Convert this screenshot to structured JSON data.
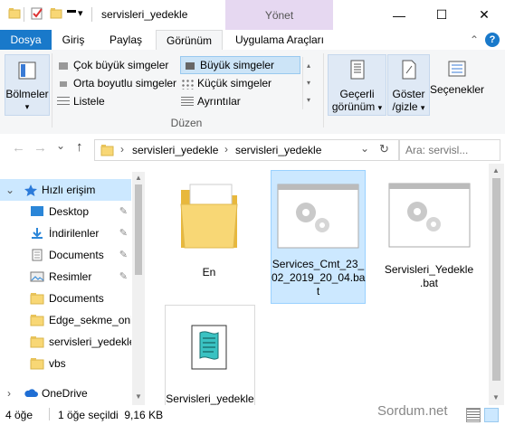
{
  "window": {
    "title": "servisleri_yedekle",
    "manage_label": "Yönet",
    "minimize": "—",
    "maximize": "☐",
    "close": "✕",
    "qa_dropdown": "▾"
  },
  "tabs": {
    "file": "Dosya",
    "home": "Giriş",
    "share": "Paylaş",
    "view": "Görünüm",
    "app_tools": "Uygulama Araçları",
    "collapse": "⌃",
    "help": "?"
  },
  "ribbon": {
    "panes": "Bölmeler",
    "panes_arrow": "▾",
    "layout_options": [
      "Çok büyük simgeler",
      "Büyük simgeler",
      "Orta boyutlu simgeler",
      "Küçük simgeler",
      "Listele",
      "Ayrıntılar"
    ],
    "layout_group": "Düzen",
    "current_view_line1": "Geçerli",
    "current_view_line2": "görünüm",
    "show_hide_line1": "Göster",
    "show_hide_line2": "/gizle",
    "options": "Seçenekler",
    "dropdown_arrow": "▾"
  },
  "nav": {
    "back": "←",
    "forward": "→",
    "recent": "⌄",
    "up": "↑",
    "breadcrumb_sep": "›",
    "breadcrumb": [
      "servisleri_yedekle",
      "servisleri_yedekle"
    ],
    "address_dropdown": "⌄",
    "refresh": "↻",
    "search_placeholder": "Ara: servisl..."
  },
  "sidebar": {
    "quick_access": "Hızlı erişim",
    "items": [
      {
        "label": "Desktop",
        "pinned": true
      },
      {
        "label": "İndirilenler",
        "pinned": true
      },
      {
        "label": "Documents",
        "pinned": true
      },
      {
        "label": "Resimler",
        "pinned": true
      },
      {
        "label": "Documents",
        "pinned": false
      },
      {
        "label": "Edge_sekme_oniz",
        "pinned": false
      },
      {
        "label": "servisleri_yedekle",
        "pinned": false
      },
      {
        "label": "vbs",
        "pinned": false
      }
    ],
    "onedrive": "OneDrive",
    "pin_glyph": "📌",
    "expand_glyph": "›"
  },
  "files": [
    {
      "name": "En",
      "type": "folder",
      "selected": false
    },
    {
      "name": "Services_Cmt_23_02_2019_20_04.bat",
      "name_lines": [
        "Services_Cmt_23_",
        "02_2019_20_04.ba",
        "t"
      ],
      "type": "bat",
      "selected": true
    },
    {
      "name": "Servisleri_Yedekle.bat",
      "name_lines": [
        "Servisleri_Yedekle",
        ".bat"
      ],
      "type": "bat",
      "selected": false
    },
    {
      "name": "Servisleri_yedekle",
      "name_lines": [
        "Servisleri_yedekle"
      ],
      "type": "script",
      "selected": false
    }
  ],
  "status": {
    "count": "4 öğe",
    "selection": "1 öğe seçildi  9,16 KB",
    "watermark": "Sordum.net"
  }
}
